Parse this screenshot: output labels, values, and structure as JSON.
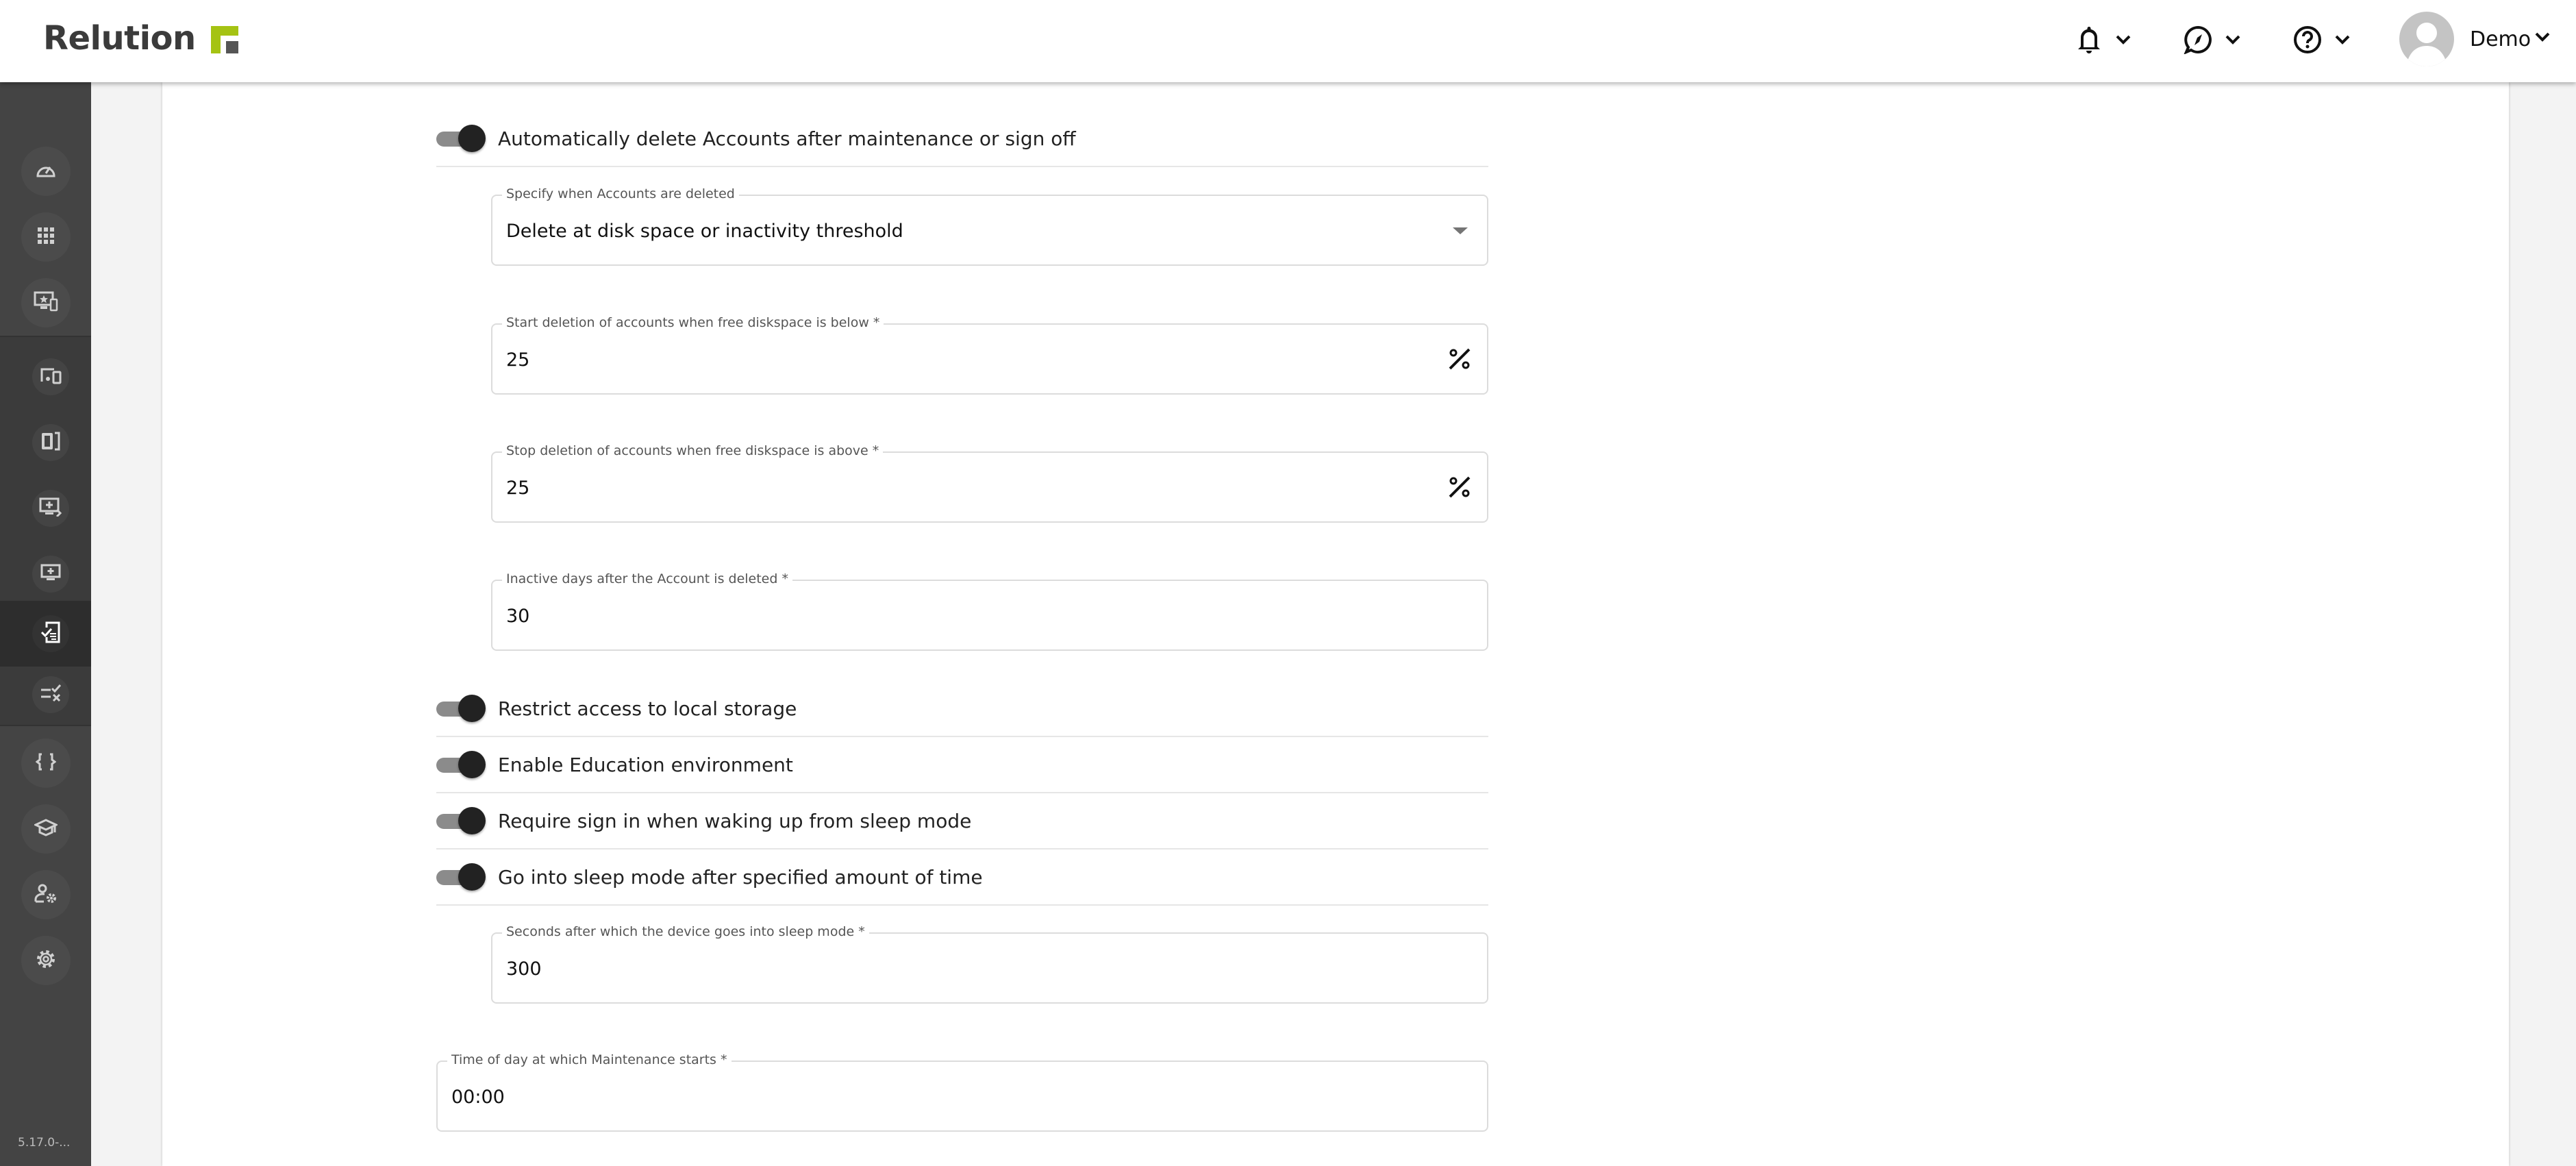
{
  "header": {
    "logo_text": "Relution",
    "brand_color": "#a5c313",
    "notifications_icon": "bell-icon",
    "discover_icon": "compass-icon",
    "help_icon": "help-circle-icon",
    "user_name": "Demo"
  },
  "sidebar": {
    "items": [
      {
        "icon": "dashboard-gauge-icon",
        "group": "top"
      },
      {
        "icon": "apps-grid-icon",
        "group": "top"
      },
      {
        "icon": "devices-star-icon",
        "group": "top"
      },
      {
        "icon": "device-groups-icon",
        "group": "sub"
      },
      {
        "icon": "tablet-phone-icon",
        "group": "sub"
      },
      {
        "icon": "enrollment-icon",
        "group": "sub"
      },
      {
        "icon": "add-device-icon",
        "group": "sub"
      },
      {
        "icon": "compliance-policy-icon",
        "group": "sub",
        "active": true
      },
      {
        "icon": "compliance-rules-icon",
        "group": "sub"
      },
      {
        "icon": "scripts-braces-icon",
        "group": "bottom"
      },
      {
        "icon": "education-cap-icon",
        "group": "bottom"
      },
      {
        "icon": "user-settings-icon",
        "group": "bottom"
      },
      {
        "icon": "settings-gear-icon",
        "group": "bottom"
      }
    ],
    "version": "5.17.0-..."
  },
  "form": {
    "auto_delete": {
      "label": "Automatically delete Accounts after maintenance or sign off",
      "enabled": true
    },
    "delete_mode": {
      "label": "Specify when Accounts are deleted",
      "value": "Delete at disk space or inactivity threshold"
    },
    "start_deletion": {
      "label": "Start deletion of accounts when free diskspace is below *",
      "value": "25",
      "unit_icon": "percent-icon"
    },
    "stop_deletion": {
      "label": "Stop deletion of accounts when free diskspace is above *",
      "value": "25",
      "unit_icon": "percent-icon"
    },
    "inactive_days": {
      "label": "Inactive days after the Account is deleted *",
      "value": "30"
    },
    "restrict_storage": {
      "label": "Restrict access to local storage",
      "enabled": true
    },
    "education_env": {
      "label": "Enable Education environment",
      "enabled": true
    },
    "require_signin": {
      "label": "Require sign in when waking up from sleep mode",
      "enabled": true
    },
    "sleep_mode": {
      "label": "Go into sleep mode after specified amount of time",
      "enabled": true
    },
    "sleep_seconds": {
      "label": "Seconds after which the device goes into sleep mode *",
      "value": "300"
    },
    "maintenance_time": {
      "label": "Time of day at which Maintenance starts *",
      "value": "00:00"
    }
  }
}
